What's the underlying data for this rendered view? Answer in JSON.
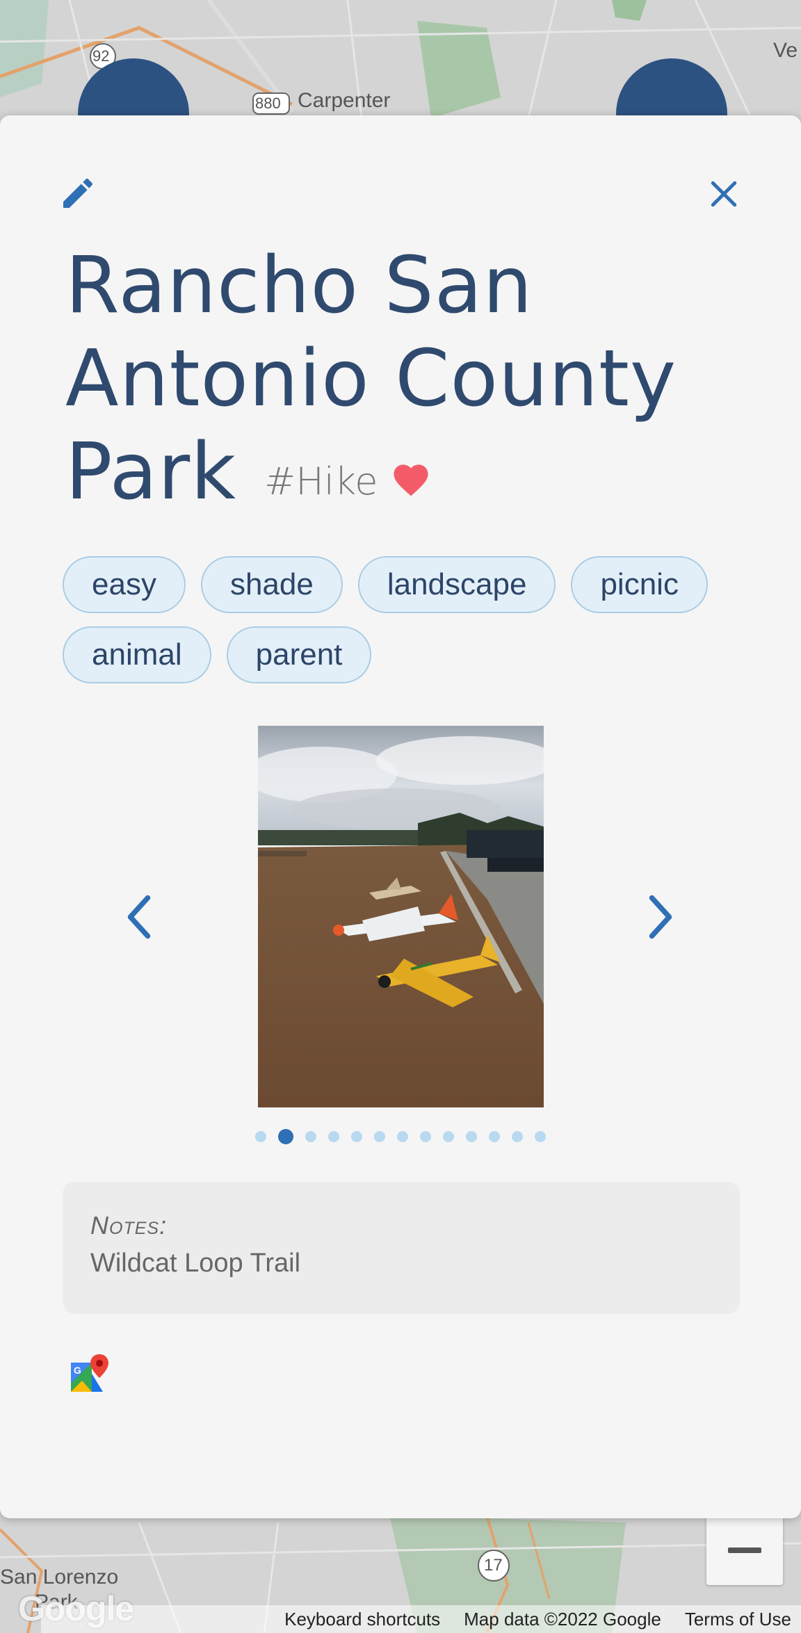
{
  "map": {
    "labels": [
      "Carpenter",
      "Ve",
      "San Lorenzo",
      "Park"
    ],
    "route_shields": [
      "92",
      "880",
      "17"
    ],
    "footer": {
      "keyboard_shortcuts": "Keyboard shortcuts",
      "map_data": "Map data ©2022 Google",
      "terms": "Terms of Use"
    },
    "logo": "Google"
  },
  "place": {
    "title": "Rancho San Antonio County Park",
    "tag": "#Hike",
    "favorite": true,
    "chips": [
      "easy",
      "shade",
      "landscape",
      "picnic",
      "animal",
      "parent"
    ]
  },
  "carousel": {
    "image_description": "photo of model airplanes on dirt path",
    "total_photos": 13,
    "active_index": 1
  },
  "notes": {
    "label": "Notes:",
    "text": "Wildcat Loop Trail"
  },
  "icons": {
    "edit": "edit-pencil-icon",
    "close": "close-icon",
    "heart": "heart-icon",
    "prev": "chevron-left-icon",
    "next": "chevron-right-icon",
    "maps": "google-maps-icon"
  },
  "colors": {
    "title": "#2f4a6e",
    "accent": "#2f6fb5",
    "heart": "#f45b69",
    "chip_bg": "#e3eff8",
    "chip_border": "#a9cde6"
  }
}
